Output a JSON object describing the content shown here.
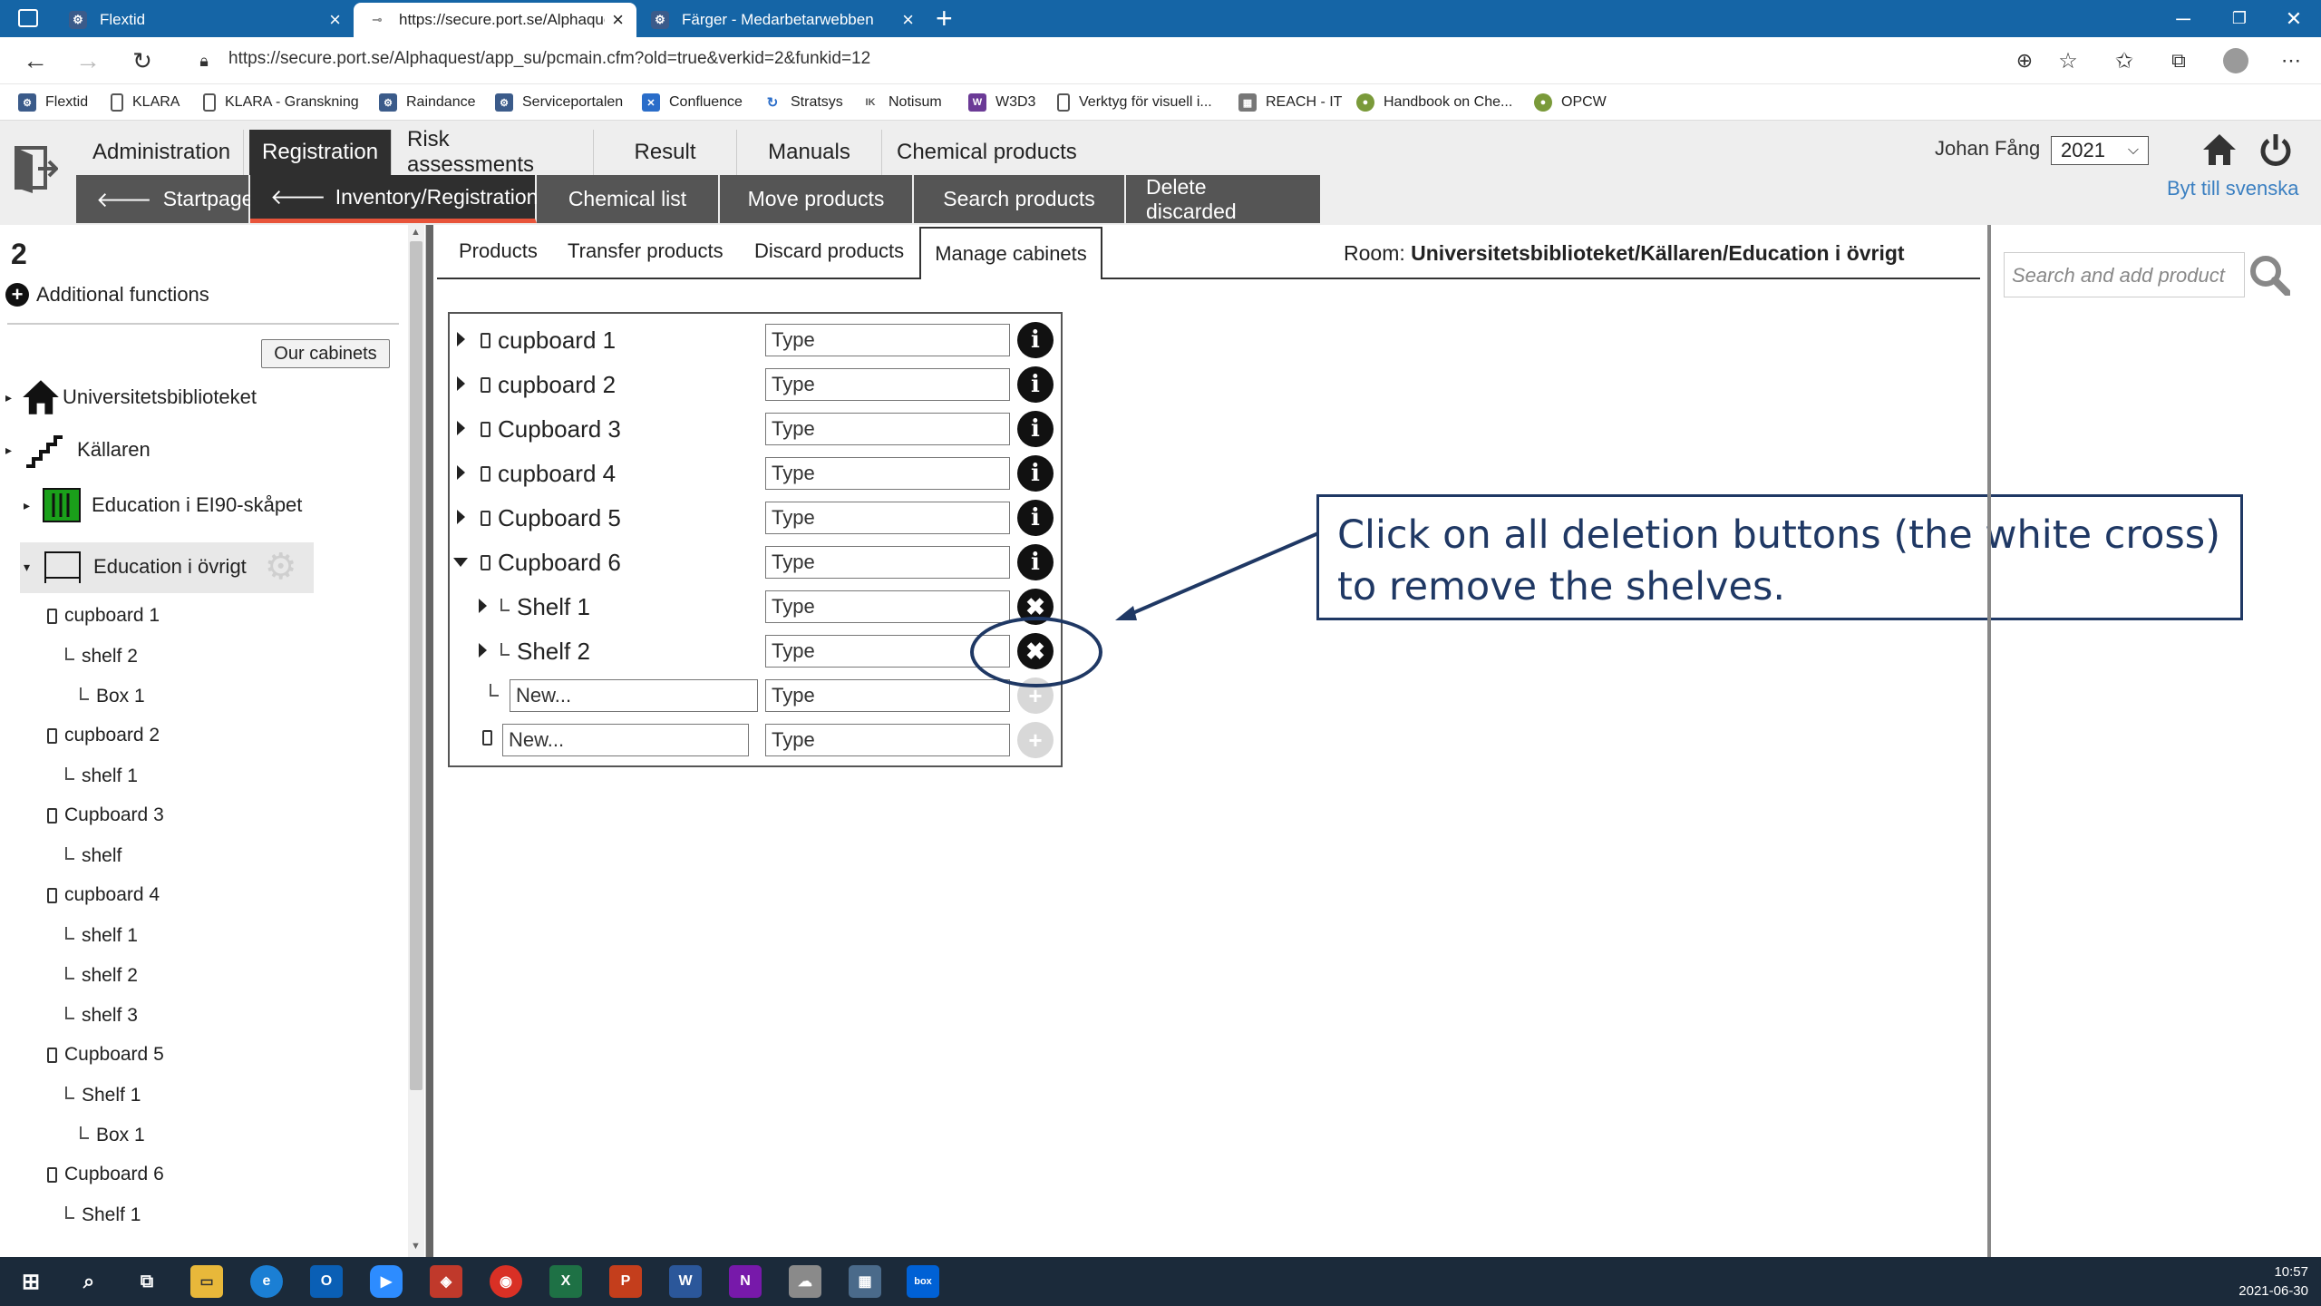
{
  "browser": {
    "tabs": [
      {
        "title": "Flextid",
        "active": false
      },
      {
        "title": "https://secure.port.se/Alphaques",
        "active": true
      },
      {
        "title": "Färger - Medarbetarwebben",
        "active": false
      }
    ],
    "new_tab": "+",
    "url": "https://secure.port.se/Alphaquest/app_su/pcmain.cfm?old=true&verkid=2&funkid=12",
    "bookmarks": [
      "Flextid",
      "KLARA",
      "KLARA - Granskning",
      "Raindance",
      "Serviceportalen",
      "Confluence",
      "Stratsys",
      "Notisum",
      "W3D3",
      "Verktyg för visuell i...",
      "REACH - IT",
      "Handbook on Che...",
      "OPCW"
    ]
  },
  "header": {
    "main_menu": [
      "Administration",
      "Registration",
      "Risk assessments",
      "Result",
      "Manuals",
      "Chemical products"
    ],
    "active_main": "Registration",
    "sub_menu": [
      "Startpage",
      "Inventory/Registration",
      "Chemical list",
      "Move products",
      "Search products",
      "Delete discarded"
    ],
    "active_sub": "Inventory/Registration",
    "user": "Johan Fång",
    "year": "2021",
    "language_link": "Byt till svenska"
  },
  "left_panel": {
    "count": "2",
    "additional_functions": "Additional functions",
    "our_cabinets_button": "Our cabinets",
    "locations": [
      "Universitetsbiblioteket",
      "Källaren",
      "Education i EI90-skåpet",
      "Education i övrigt"
    ],
    "tree": [
      {
        "label": "cupboard 1",
        "level": 0,
        "icon": "cupboard"
      },
      {
        "label": "shelf 2",
        "level": 1
      },
      {
        "label": "Box 1",
        "level": 2
      },
      {
        "label": "cupboard 2",
        "level": 0,
        "icon": "cupboard"
      },
      {
        "label": "shelf 1",
        "level": 1
      },
      {
        "label": "Cupboard 3",
        "level": 0,
        "icon": "cupboard"
      },
      {
        "label": "shelf",
        "level": 1
      },
      {
        "label": "cupboard 4",
        "level": 0,
        "icon": "cupboard"
      },
      {
        "label": "shelf 1",
        "level": 1
      },
      {
        "label": "shelf 2",
        "level": 1
      },
      {
        "label": "shelf 3",
        "level": 1
      },
      {
        "label": "Cupboard 5",
        "level": 0,
        "icon": "cupboard"
      },
      {
        "label": "Shelf 1",
        "level": 1
      },
      {
        "label": "Box 1",
        "level": 2
      },
      {
        "label": "Cupboard 6",
        "level": 0,
        "icon": "cupboard"
      },
      {
        "label": "Shelf 1",
        "level": 1
      }
    ]
  },
  "main": {
    "tabs": [
      "Products",
      "Transfer products",
      "Discard products",
      "Manage cabinets"
    ],
    "active_tab": "Manage cabinets",
    "room_label": "Room:",
    "room_path": "Universitetsbiblioteket/Källaren/Education i övrigt",
    "cabinets": [
      {
        "name": "cupboard 1",
        "type_placeholder": "Type",
        "action": "info"
      },
      {
        "name": "cupboard 2",
        "type_placeholder": "Type",
        "action": "info"
      },
      {
        "name": "Cupboard 3",
        "type_placeholder": "Type",
        "action": "info"
      },
      {
        "name": "cupboard 4",
        "type_placeholder": "Type",
        "action": "info"
      },
      {
        "name": "Cupboard 5",
        "type_placeholder": "Type",
        "action": "info"
      },
      {
        "name": "Cupboard 6",
        "type_placeholder": "Type",
        "action": "info",
        "expanded": true
      },
      {
        "name": "Shelf 1",
        "type_placeholder": "Type",
        "action": "delete",
        "child": true
      },
      {
        "name": "Shelf 2",
        "type_placeholder": "Type",
        "action": "delete",
        "child": true
      }
    ],
    "new_shelf_placeholder": "New...",
    "new_cabinet_placeholder": "New...",
    "type_placeholder": "Type",
    "callout": "Click on all deletion buttons (the white cross) to remove the shelves."
  },
  "right_panel": {
    "search_placeholder": "Search and add product"
  },
  "taskbar": {
    "time": "10:57",
    "date": "2021-06-30"
  },
  "colors": {
    "tabstrip": "#1565a6",
    "menu_active": "#2f2f2f",
    "submenu": "#555555",
    "accent_underline": "#e8543a",
    "callout": "#1f3864",
    "link": "#3a7fc1"
  }
}
